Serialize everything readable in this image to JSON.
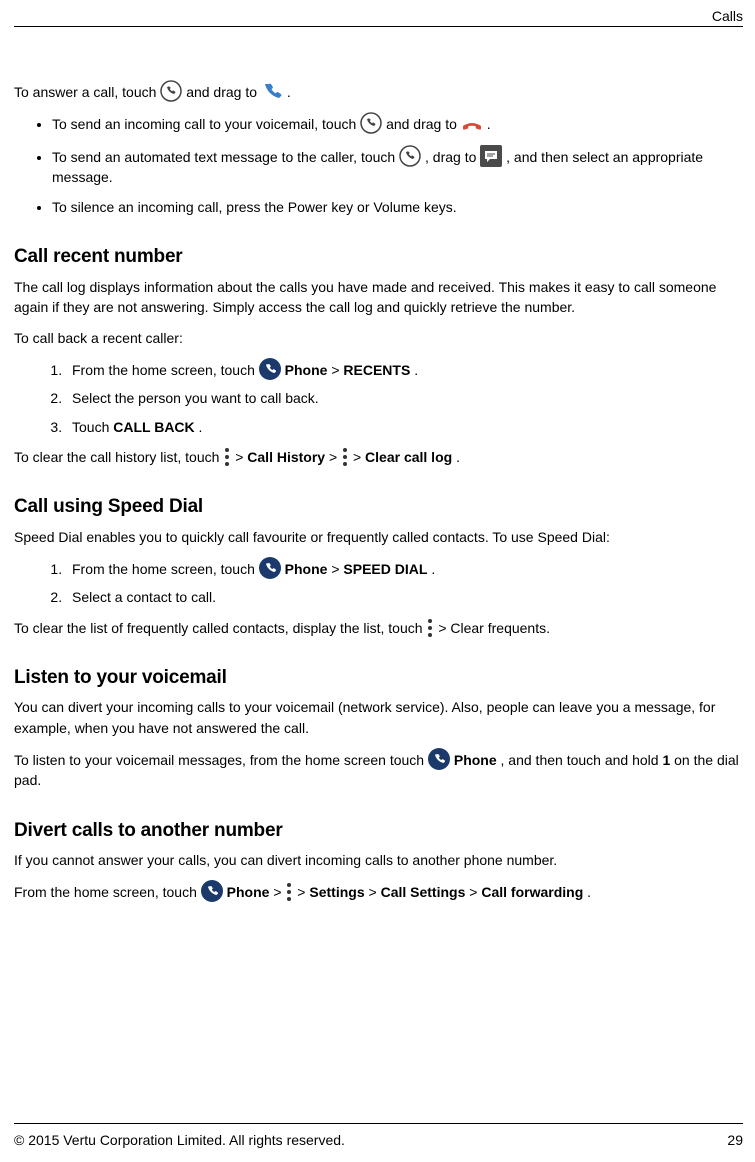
{
  "header_label": "Calls",
  "intro": {
    "p1_a": "To answer a call, touch ",
    "p1_b": " and drag to  ",
    "p1_c": " ."
  },
  "intro_list": {
    "i1_a": "To send an incoming call to your voicemail, touch ",
    "i1_b": " and drag to  ",
    "i1_c": " .",
    "i2_a": "To send an automated text message to the caller, touch ",
    "i2_b": ", drag to ",
    "i2_c": ", and then select an appropriate message.",
    "i3": "To silence an incoming call, press the Power key or Volume keys."
  },
  "s1": {
    "h": "Call recent number",
    "p1": "The call log displays information about the calls you have made and received. This makes it easy to call someone again if they are not answering. Simply access the call log and quickly retrieve the number.",
    "p2": "To call back a recent caller:",
    "o1_a": "From the home screen, touch ",
    "o1_b": " ",
    "o1_phone": "Phone",
    "o1_gt": " > ",
    "o1_recents": "RECENTS",
    "o1_dot": ".",
    "o2": "Select the person you want to call back.",
    "o3_a": "Touch ",
    "o3_cb": "CALL BACK",
    "o3_dot": ".",
    "p3_a": "To clear the call history list, touch ",
    "p3_gt1": " > ",
    "p3_ch": "Call History",
    "p3_gt2": " > ",
    "p3_gt3": " > ",
    "p3_ccl": "Clear call log",
    "p3_dot": "."
  },
  "s2": {
    "h": "Call using Speed Dial",
    "p1": "Speed Dial enables you to quickly call favourite or frequently called contacts. To use Speed Dial:",
    "o1_a": "From the home screen, touch ",
    "o1_b": " ",
    "o1_phone": "Phone",
    "o1_gt": " > ",
    "o1_sd": "SPEED DIAL",
    "o1_dot": ".",
    "o2": "Select a contact to call.",
    "p2_a": "To clear the list of frequently called contacts, display the list, touch ",
    "p2_b": " > Clear frequents."
  },
  "s3": {
    "h": "Listen to your voicemail",
    "p1": "You can divert your incoming calls to your voicemail (network service). Also, people can leave you a message, for example, when you have not answered the call.",
    "p2_a": "To listen to your voicemail messages, from the home screen touch ",
    "p2_b": " ",
    "p2_phone": "Phone",
    "p2_c": ", and then touch and hold ",
    "p2_one": "1",
    "p2_d": " on the dial pad."
  },
  "s4": {
    "h": "Divert calls to another number",
    "p1": "If you cannot answer your calls, you can divert incoming calls to another phone number.",
    "p2_a": "From the home screen, touch ",
    "p2_b": " ",
    "p2_phone": "Phone",
    "p2_gt1": " > ",
    "p2_gt2": " > ",
    "p2_settings": "Settings",
    "p2_gt3": " > ",
    "p2_cs": "Call Settings",
    "p2_gt4": " > ",
    "p2_cf": "Call forwarding",
    "p2_dot": "."
  },
  "footer": {
    "copyright": "© 2015 Vertu Corporation Limited. All rights reserved.",
    "page": "29"
  }
}
